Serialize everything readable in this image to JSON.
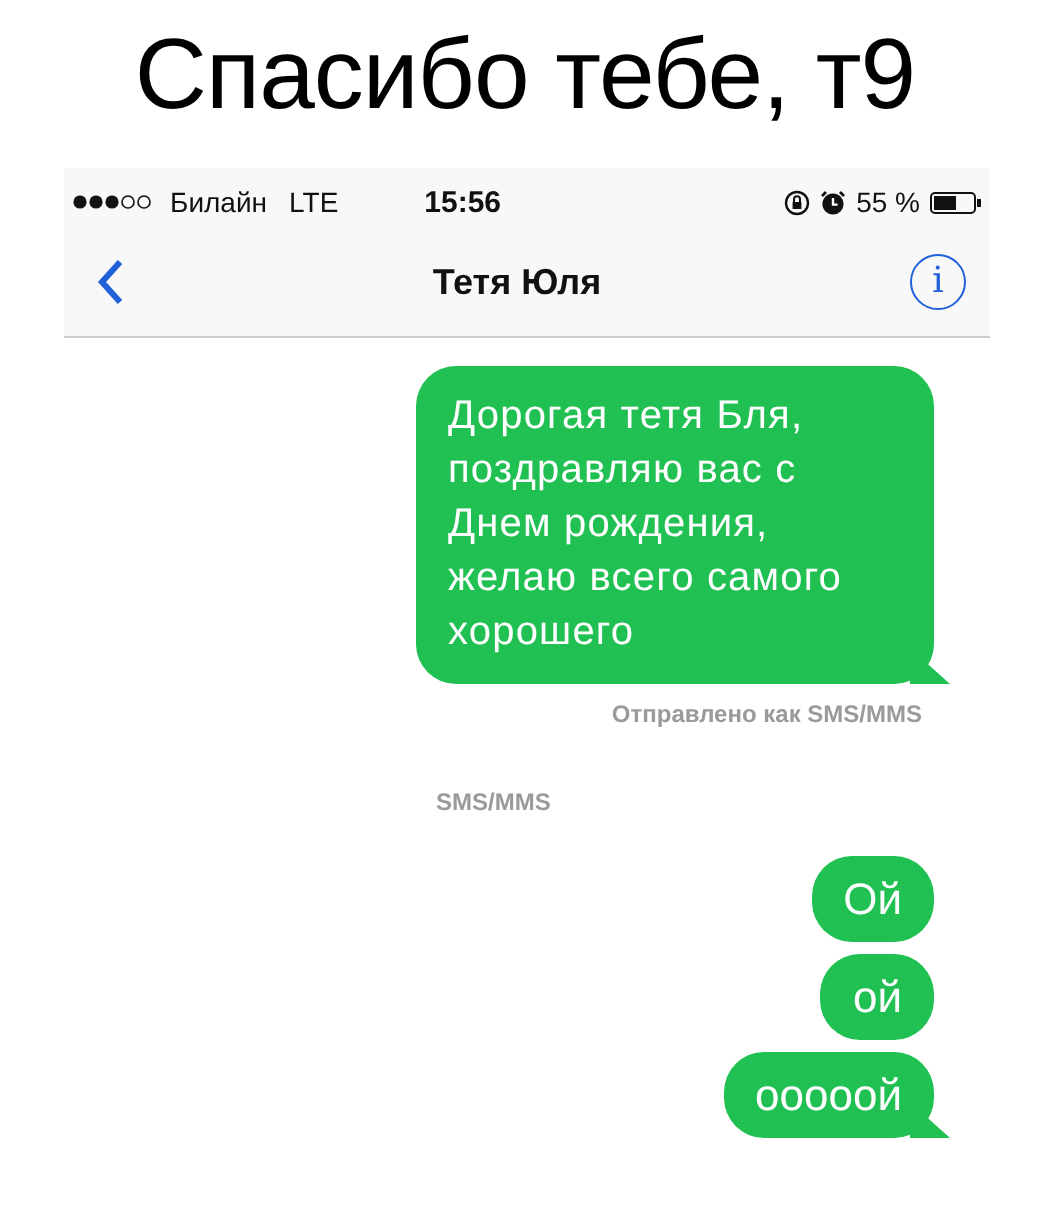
{
  "caption": "Спасибо тебе, т9",
  "status_bar": {
    "carrier": "Билайн",
    "network": "LTE",
    "time": "15:56",
    "battery": "55 %"
  },
  "nav": {
    "title": "Тетя Юля",
    "info": "i"
  },
  "messages": [
    {
      "kind": "bubble",
      "text": "Дорогая тетя Бля, поздравляю вас с Днем рождения, желаю всего самого хорошего",
      "tail": true
    },
    {
      "kind": "status",
      "text": "Отправлено как SMS/MMS"
    },
    {
      "kind": "service",
      "text": "SMS/MMS"
    },
    {
      "kind": "bubble",
      "text": "Ой",
      "tail": false
    },
    {
      "kind": "bubble",
      "text": "ой",
      "tail": false
    },
    {
      "kind": "bubble",
      "text": "ооооой",
      "tail": true
    }
  ]
}
